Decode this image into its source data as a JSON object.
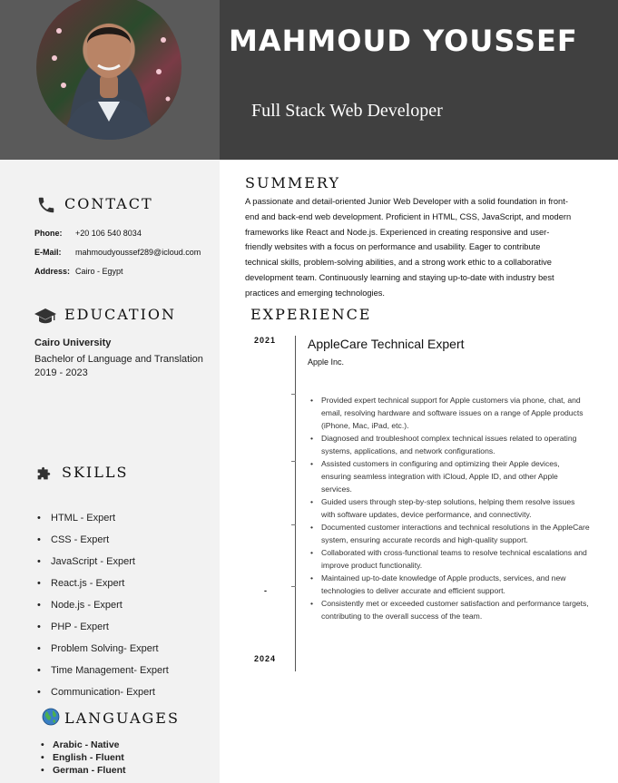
{
  "header": {
    "name": "MAHMOUD YOUSSEF",
    "role": "Full Stack Web Developer"
  },
  "colors": {
    "header_dark": "#404040",
    "header_left": "#5a5a5a",
    "sidebar": "#f2f2f2"
  },
  "contact": {
    "title": "CONTACT",
    "icon": "phone-icon",
    "phone_label": "Phone:",
    "phone": "+20 106 540 8034",
    "email_label": "E-Mail:",
    "email": "mahmoudyoussef289@icloud.com",
    "address_label": "Address:",
    "address": "Cairo - Egypt"
  },
  "education": {
    "title": "EDUCATION",
    "icon": "graduation-cap-icon",
    "school": "Cairo University",
    "degree": "Bachelor of Language and Translation",
    "years": "2019 - 2023"
  },
  "skills": {
    "title": "SKILLS",
    "icon": "puzzle-icon",
    "items": [
      "HTML - Expert",
      "CSS - Expert",
      "JavaScript - Expert",
      "React.js - Expert",
      "Node.js - Expert",
      "PHP - Expert",
      "Problem Solving- Expert",
      "Time Management- Expert",
      "Communication- Expert"
    ]
  },
  "languages": {
    "title": "LANGUAGES",
    "icon": "globe-icon",
    "items": [
      "Arabic - Native",
      "English - Fluent",
      "German - Fluent"
    ]
  },
  "summary": {
    "title": "SUMMERY",
    "text": "A passionate and detail-oriented Junior Web Developer with a solid foundation in front-end and back-end web development. Proficient in HTML, CSS, JavaScript, and modern frameworks like React and Node.js. Experienced in creating responsive and user-friendly websites with a focus on performance and usability. Eager to contribute technical skills, problem-solving abilities, and a strong work ethic to a collaborative development team. Continuously learning and staying up-to-date with industry best practices and emerging technologies."
  },
  "experience": {
    "title": "EXPERIENCE",
    "start_year": "2021",
    "separator": "-",
    "end_year": "2024",
    "job_title": "AppleCare Technical Expert",
    "company": "Apple Inc.",
    "bullets": [
      "Provided expert technical support for Apple customers via phone, chat, and email, resolving hardware and software issues on a range of Apple products (iPhone, Mac, iPad, etc.).",
      "Diagnosed and troubleshoot complex technical issues related to operating systems, applications, and network configurations.",
      "Assisted customers in configuring and optimizing their Apple devices, ensuring seamless integration with iCloud, Apple ID, and other Apple services.",
      "Guided users through step-by-step solutions, helping them resolve issues with software updates, device performance, and connectivity.",
      "Documented customer interactions and technical resolutions in the AppleCare system, ensuring accurate records and high-quality support.",
      "Collaborated with cross-functional teams to resolve technical escalations and improve product functionality.",
      "Maintained up-to-date knowledge of Apple products, services, and new technologies to deliver accurate and efficient support.",
      "Consistently met or exceeded customer satisfaction and performance targets, contributing to the overall success of the team."
    ]
  }
}
